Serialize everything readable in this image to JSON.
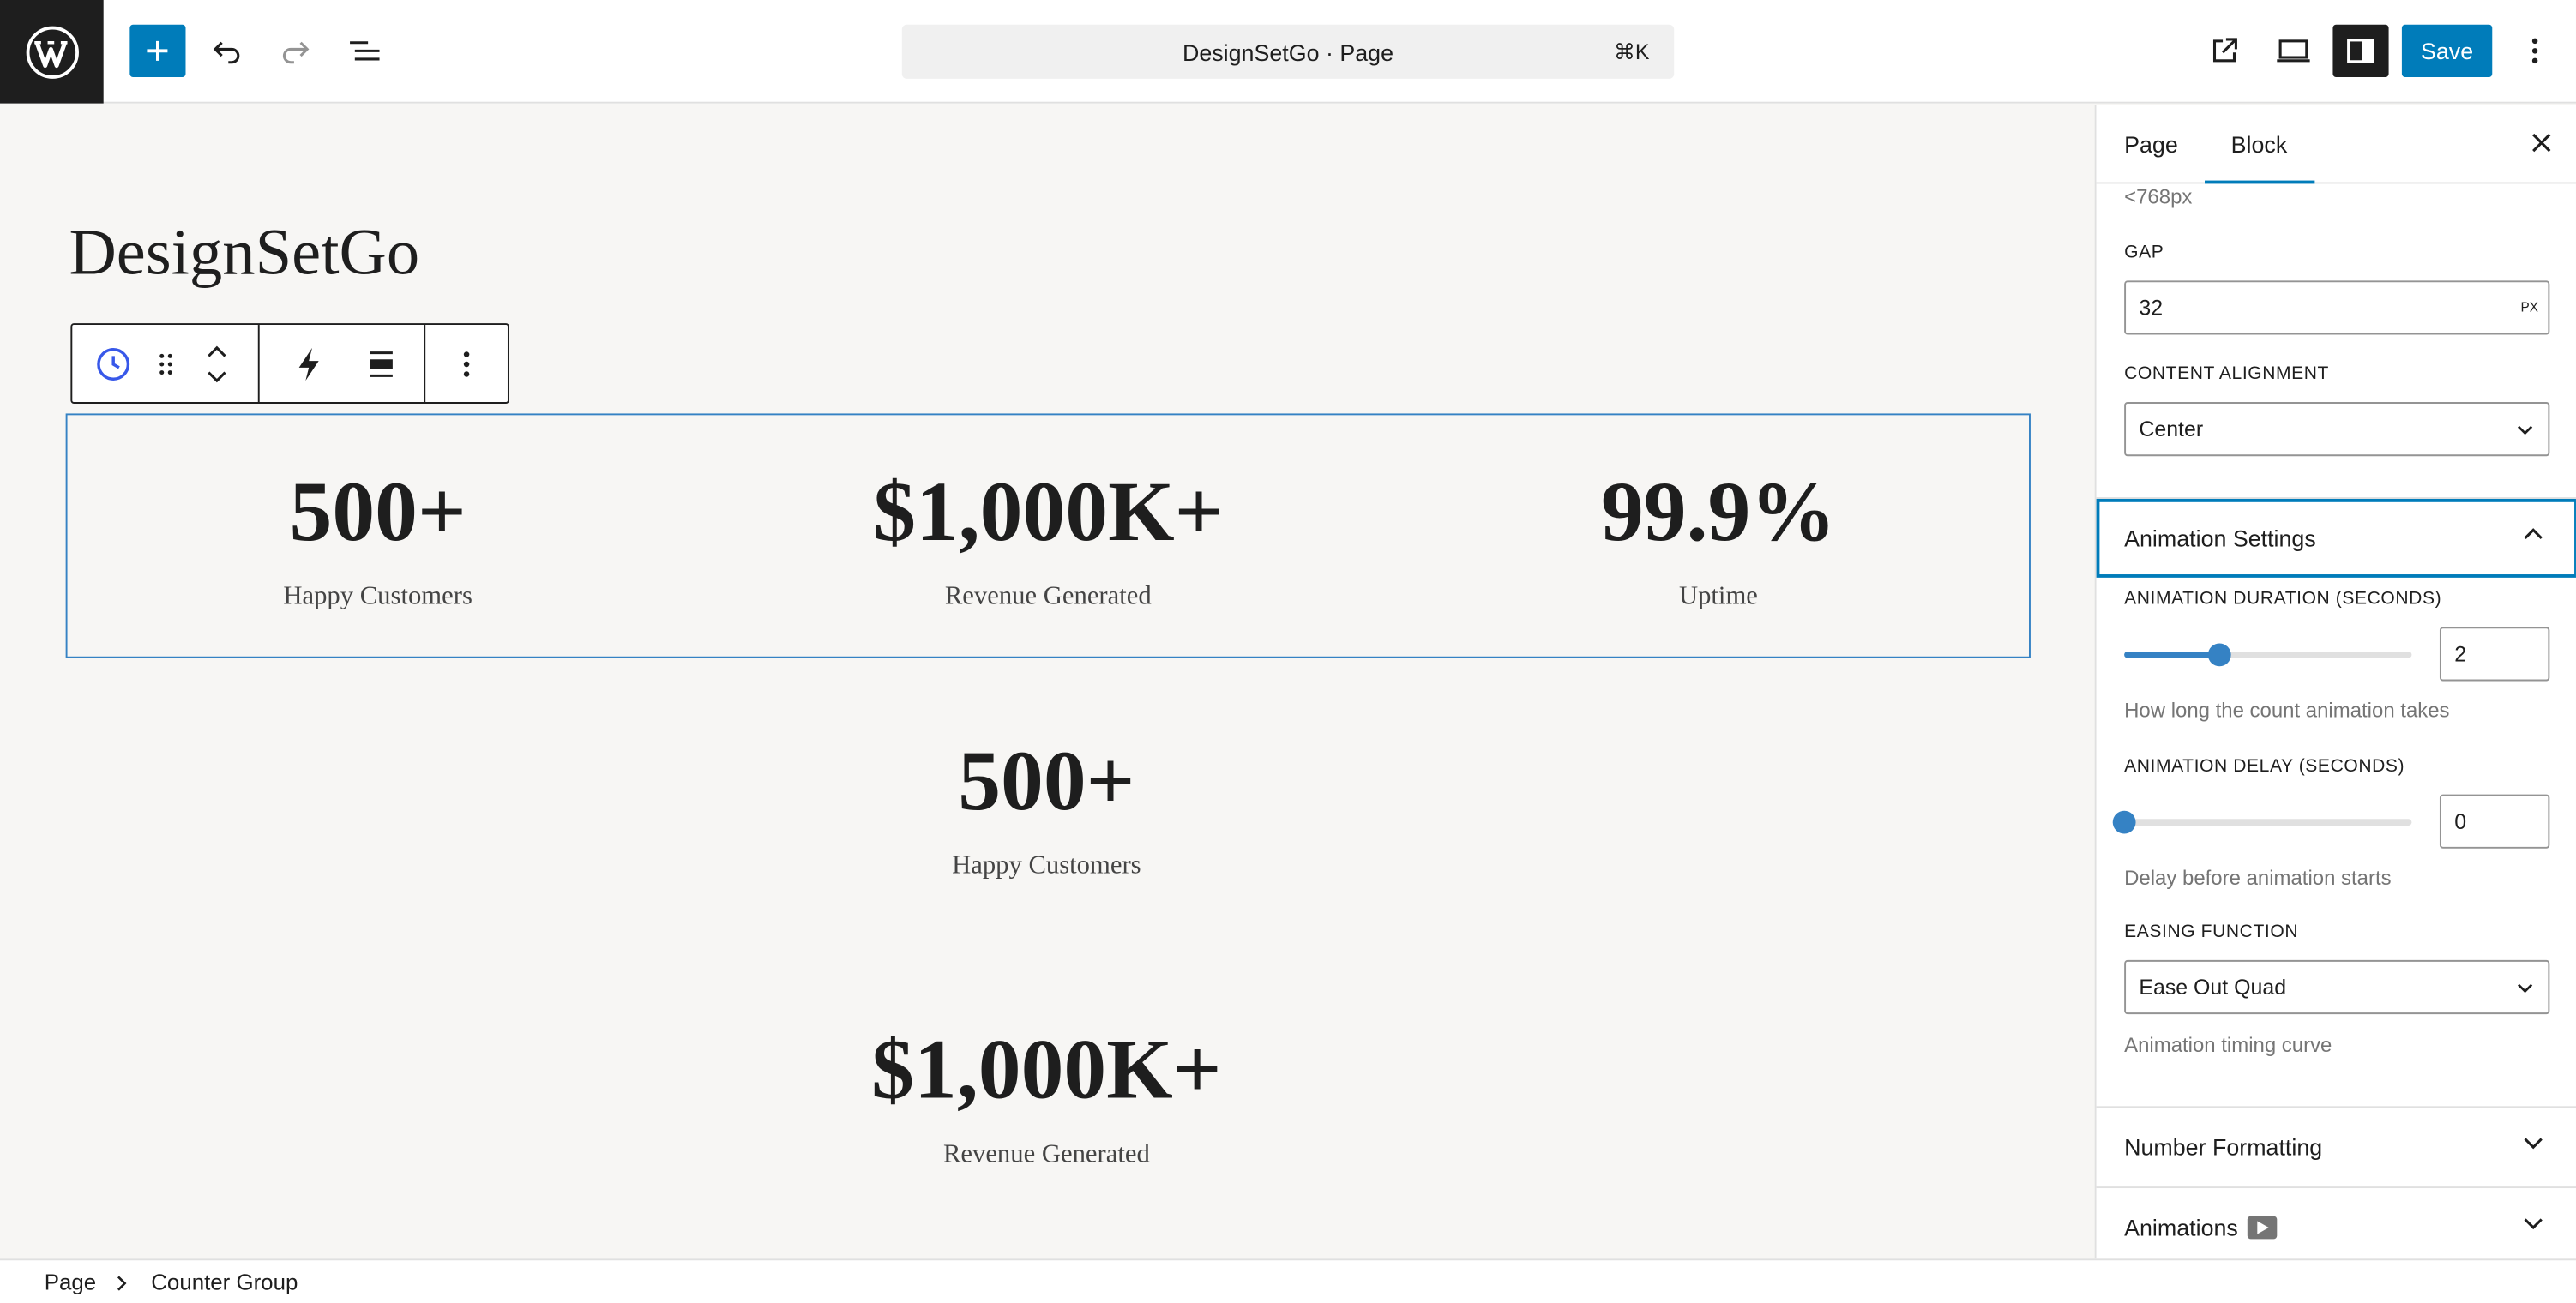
{
  "app": {
    "title": "DesignSetGo · Page",
    "shortcut": "⌘K",
    "save_label": "Save",
    "accent": "#007cba"
  },
  "toolbar_icons": [
    "wordpress-logo",
    "plus-icon",
    "undo-icon",
    "redo-icon",
    "list-view-icon",
    "external-link-icon",
    "desktop-preview-icon",
    "settings-sidebar-icon",
    "more-vertical-icon"
  ],
  "canvas": {
    "site_title": "DesignSetGo",
    "block_toolbar_icons": [
      "counter-clock-icon",
      "drag-handle-icon",
      "move-up-icon",
      "move-down-icon",
      "lightning-icon",
      "justify-icon",
      "more-vertical-icon"
    ],
    "counter_group": [
      {
        "number": "500+",
        "label": "Happy Customers"
      },
      {
        "number": "$1,000K+",
        "label": "Revenue Generated"
      },
      {
        "number": "99.9%",
        "label": "Uptime"
      }
    ],
    "stacked_counters": [
      {
        "number": "500+",
        "label": "Happy Customers"
      },
      {
        "number": "$1,000K+",
        "label": "Revenue Generated"
      }
    ]
  },
  "sidebar": {
    "tabs": [
      "Page",
      "Block"
    ],
    "active_tab": "Block",
    "breakpoint_note": "<768px",
    "gap": {
      "label": "GAP",
      "value": "32",
      "unit": "PX"
    },
    "content_alignment": {
      "label": "CONTENT ALIGNMENT",
      "value": "Center"
    },
    "animation_panel": {
      "title": "Animation Settings",
      "duration": {
        "label": "ANIMATION DURATION (SECONDS)",
        "value": "2",
        "slider_fraction": 0.333,
        "help": "How long the count animation takes"
      },
      "delay": {
        "label": "ANIMATION DELAY (SECONDS)",
        "value": "0",
        "slider_fraction": 0,
        "help": "Delay before animation starts"
      },
      "easing": {
        "label": "EASING FUNCTION",
        "value": "Ease Out Quad",
        "help": "Animation timing curve"
      }
    },
    "collapsed_panels": [
      "Number Formatting",
      "Animations"
    ]
  },
  "breadcrumb": [
    "Page",
    "Counter Group"
  ]
}
